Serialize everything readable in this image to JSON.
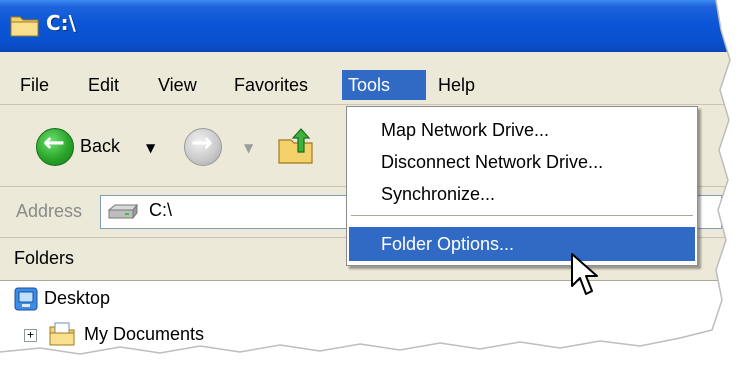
{
  "window": {
    "title": "C:\\"
  },
  "menubar": {
    "items": [
      "File",
      "Edit",
      "View",
      "Favorites",
      "Tools",
      "Help"
    ],
    "active": "Tools"
  },
  "toolbar": {
    "back_label": "Back"
  },
  "address": {
    "label": "Address",
    "value": "C:\\"
  },
  "folders": {
    "header": "Folders",
    "tree": [
      "Desktop",
      "My Documents"
    ]
  },
  "tools_menu": {
    "items": [
      "Map Network Drive...",
      "Disconnect Network Drive...",
      "Synchronize...",
      "Folder Options..."
    ],
    "highlighted": "Folder Options..."
  },
  "colors": {
    "title_bar": "#0a56d6",
    "menu_highlight": "#316ac5",
    "chrome": "#ece9d8"
  }
}
